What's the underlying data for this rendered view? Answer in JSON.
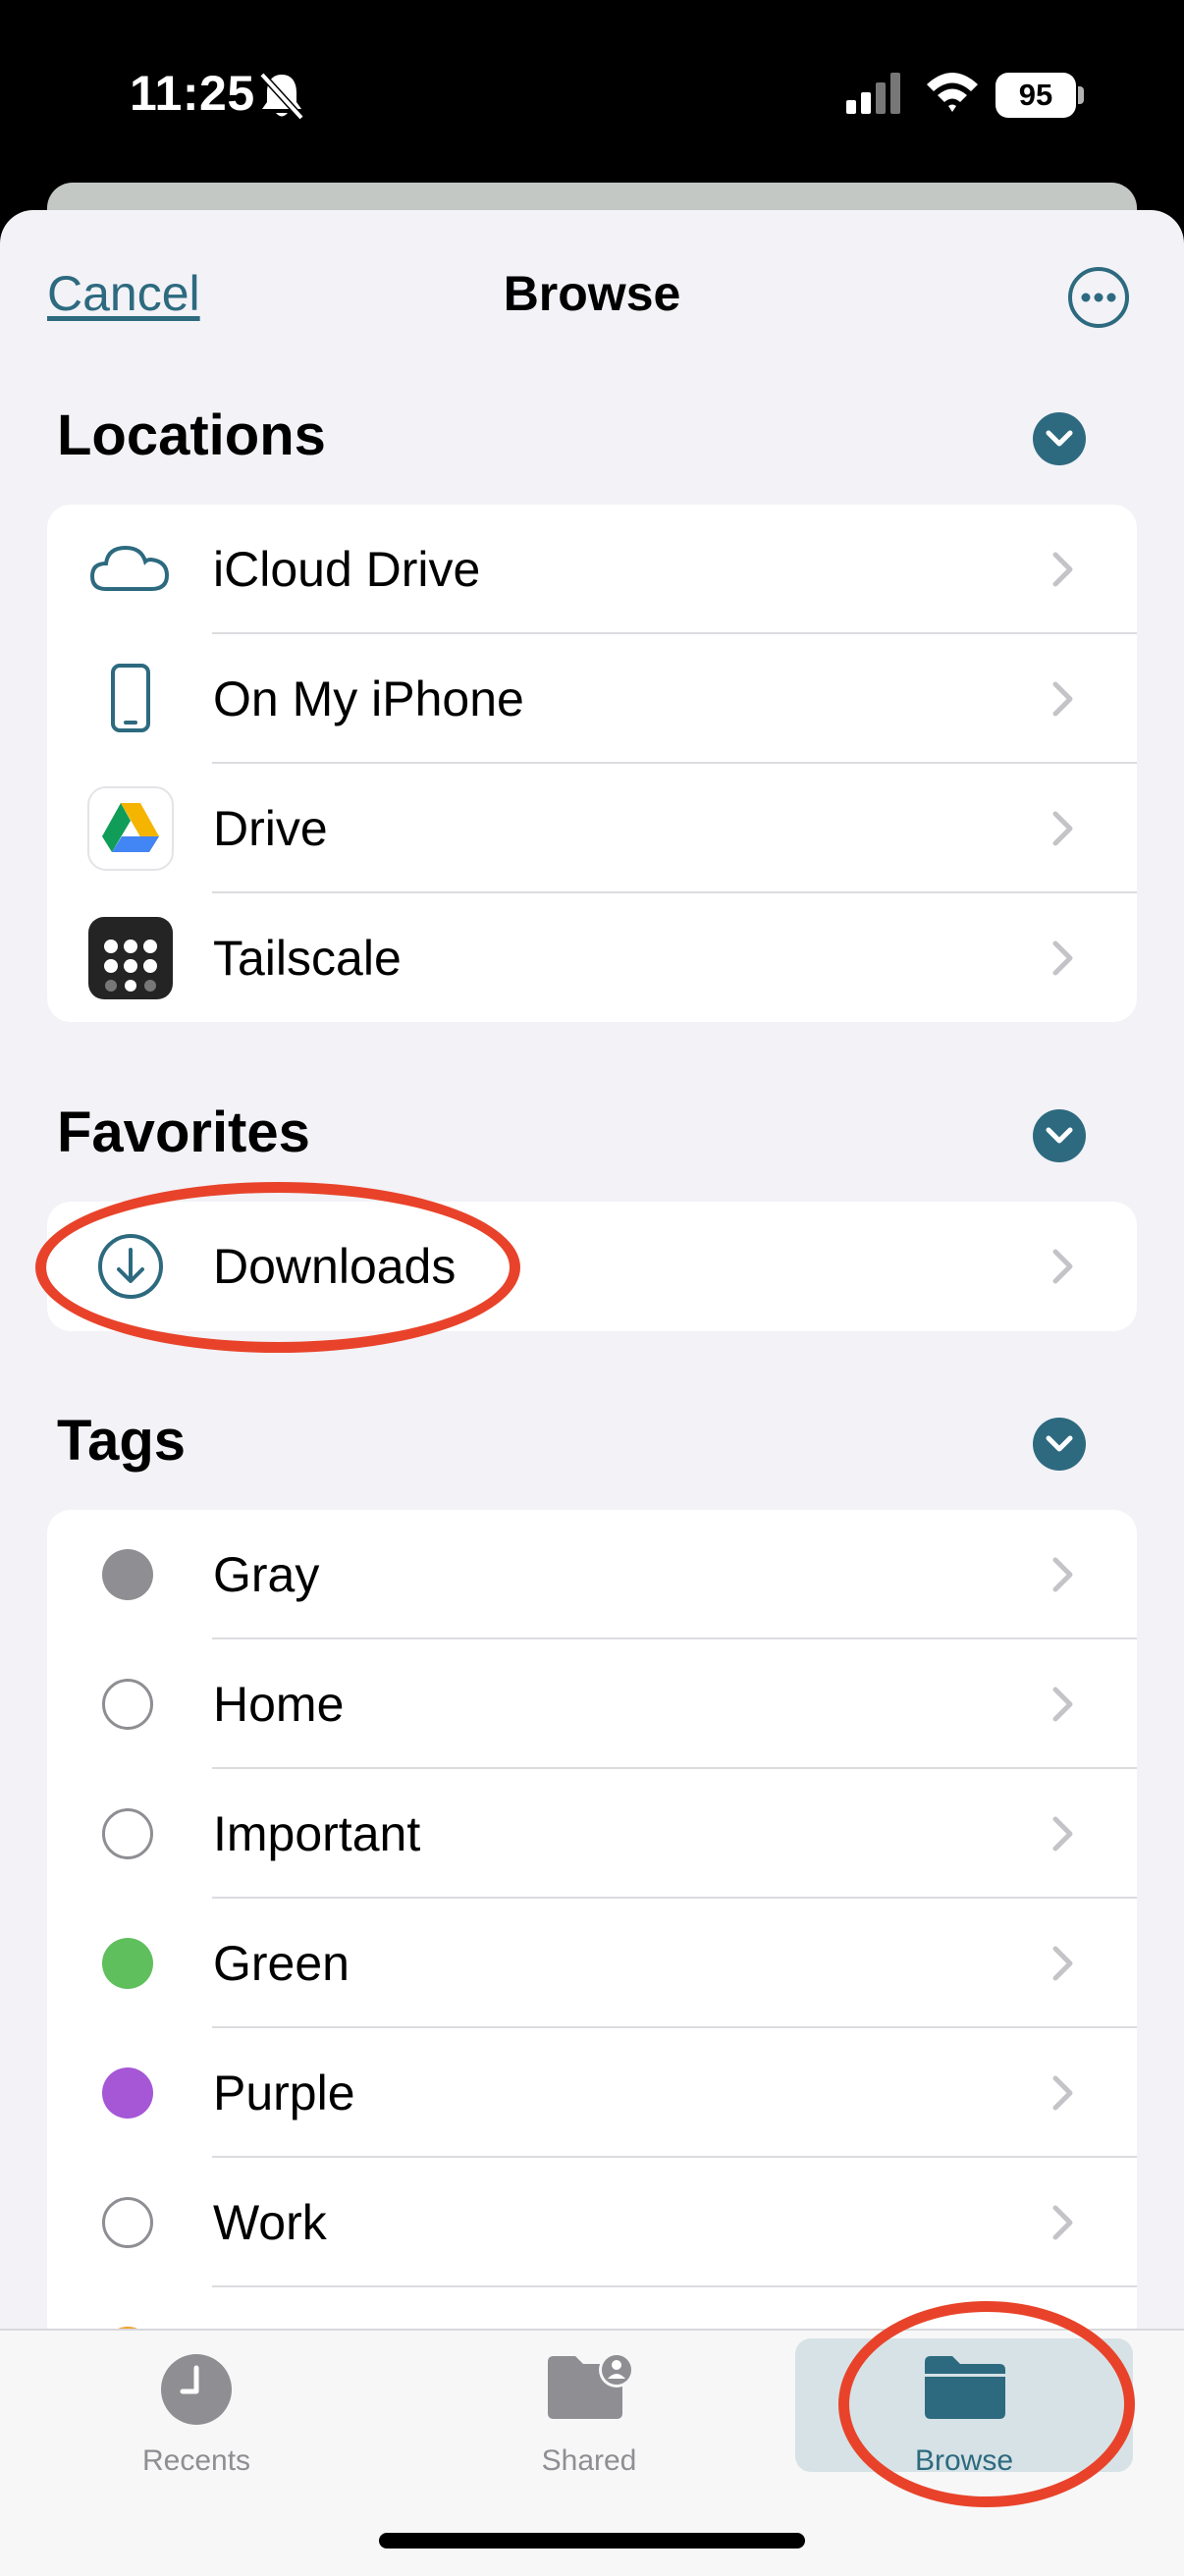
{
  "status_bar": {
    "time": "11:25",
    "battery": "95"
  },
  "nav": {
    "cancel": "Cancel",
    "title": "Browse"
  },
  "locations": {
    "title": "Locations",
    "items": [
      {
        "label": "iCloud Drive",
        "icon": "cloud-icon"
      },
      {
        "label": "On My iPhone",
        "icon": "iphone-icon"
      },
      {
        "label": "Drive",
        "icon": "google-drive-icon"
      },
      {
        "label": "Tailscale",
        "icon": "tailscale-icon"
      }
    ]
  },
  "favorites": {
    "title": "Favorites",
    "items": [
      {
        "label": "Downloads",
        "icon": "download-circle-icon"
      }
    ]
  },
  "tags": {
    "title": "Tags",
    "items": [
      {
        "label": "Gray",
        "color": "#8e8e93"
      },
      {
        "label": "Home",
        "color": ""
      },
      {
        "label": "Important",
        "color": ""
      },
      {
        "label": "Green",
        "color": "#5fbf5c"
      },
      {
        "label": "Purple",
        "color": "#a557d6"
      },
      {
        "label": "Work",
        "color": ""
      }
    ]
  },
  "tab_bar": {
    "tabs": [
      {
        "label": "Recents",
        "icon": "clock-icon",
        "active": false
      },
      {
        "label": "Shared",
        "icon": "shared-folder-icon",
        "active": false
      },
      {
        "label": "Browse",
        "icon": "folder-icon",
        "active": true
      }
    ]
  },
  "colors": {
    "accent": "#2d6a7f",
    "annotation": "#e8432a"
  }
}
